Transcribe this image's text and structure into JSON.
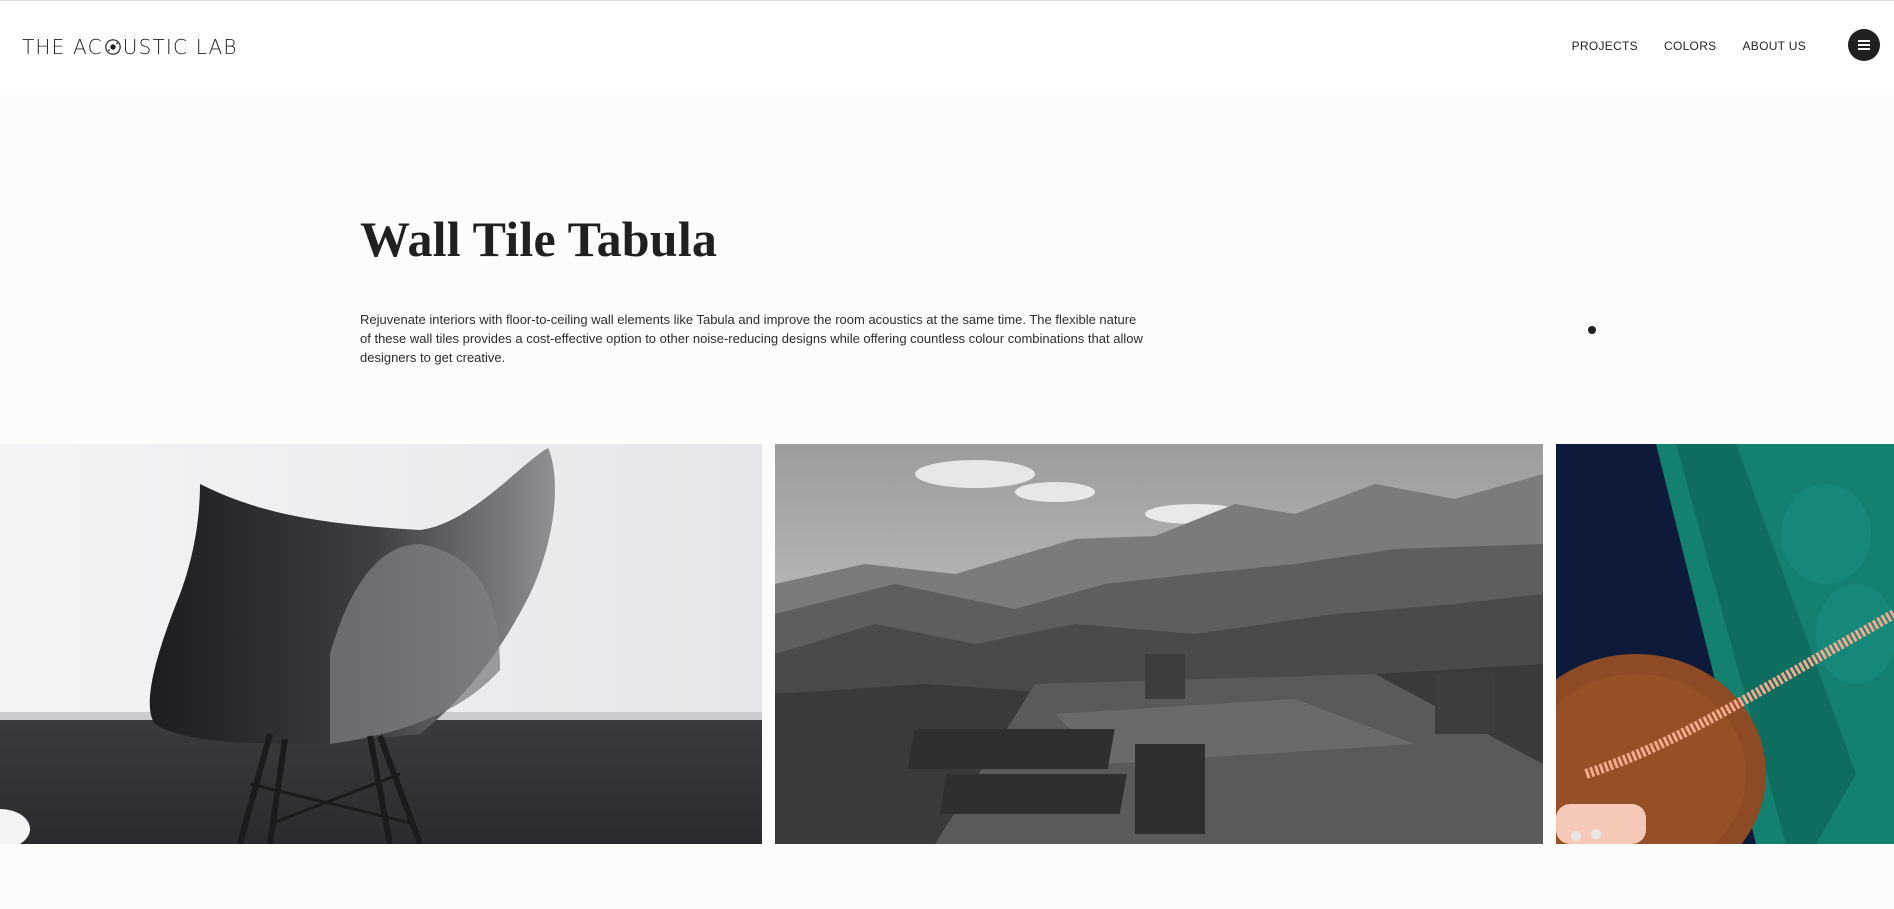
{
  "header": {
    "logo_text_a": "THE AC",
    "logo_text_b": "USTIC LAB",
    "nav": [
      {
        "label": "PROJECTS"
      },
      {
        "label": "COLORS"
      },
      {
        "label": "ABOUT US"
      }
    ],
    "menu_icon": "hamburger-icon"
  },
  "hero": {
    "title": "Wall Tile Tabula",
    "description": "Rejuvenate interiors with floor-to-ceiling wall elements like Tabula and improve the room acoustics at the same time. The flexible nature of these wall tiles provides a cost-effective option to other noise-reducing designs while offering countless colour combinations that allow designers to get creative."
  },
  "gallery": {
    "images": [
      {
        "subject": "black-chair-photo"
      },
      {
        "subject": "mountain-landscape-photo"
      },
      {
        "subject": "green-sofa-telephone-photo"
      }
    ]
  },
  "colors": {
    "text": "#1f211f",
    "background": "#fcfcfc"
  }
}
